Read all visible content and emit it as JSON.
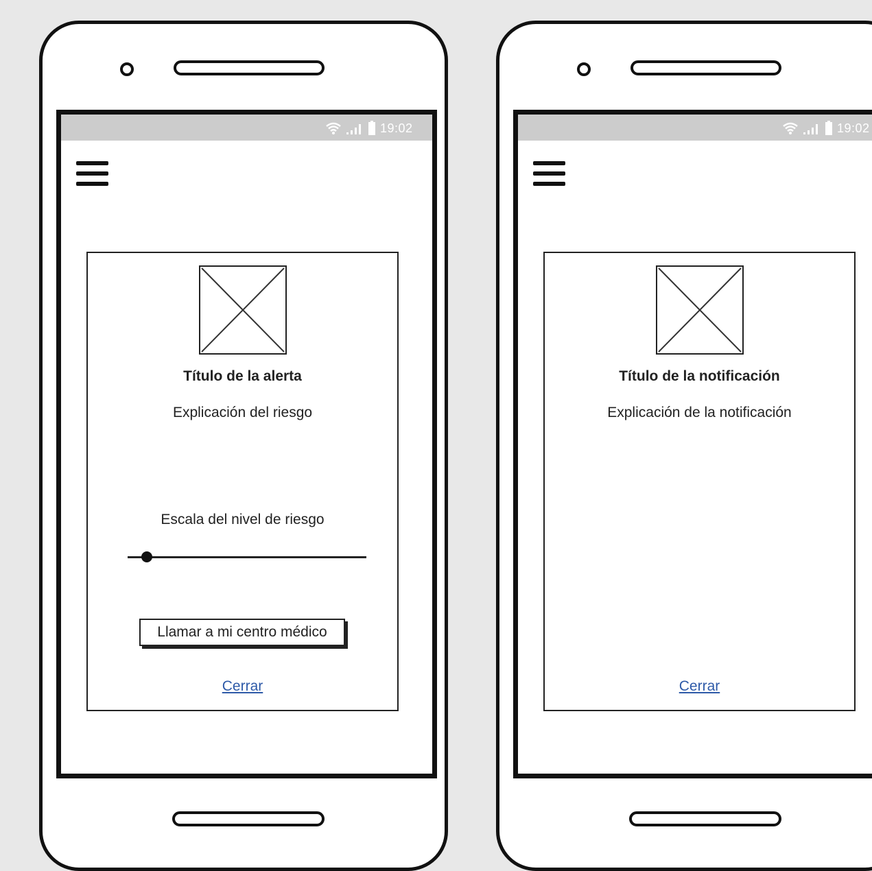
{
  "status_bar": {
    "time": "19:02",
    "icons": [
      "wifi-icon",
      "signal-icon",
      "battery-icon"
    ]
  },
  "alert_screen": {
    "title": "Título de la alerta",
    "explanation": "Explicación del riesgo",
    "scale_label": "Escala del nivel de riesgo",
    "risk_level": 0.08,
    "call_button_label": "Llamar a mi centro médico",
    "close_link": "Cerrar"
  },
  "notification_screen": {
    "title": "Título de la notificación",
    "explanation": "Explicación de la notificación",
    "close_link": "Cerrar"
  },
  "colors": {
    "status_bar": "#cccccc",
    "link": "#2e5aa8",
    "outline": "#111111",
    "background": "#e8e8e8"
  }
}
